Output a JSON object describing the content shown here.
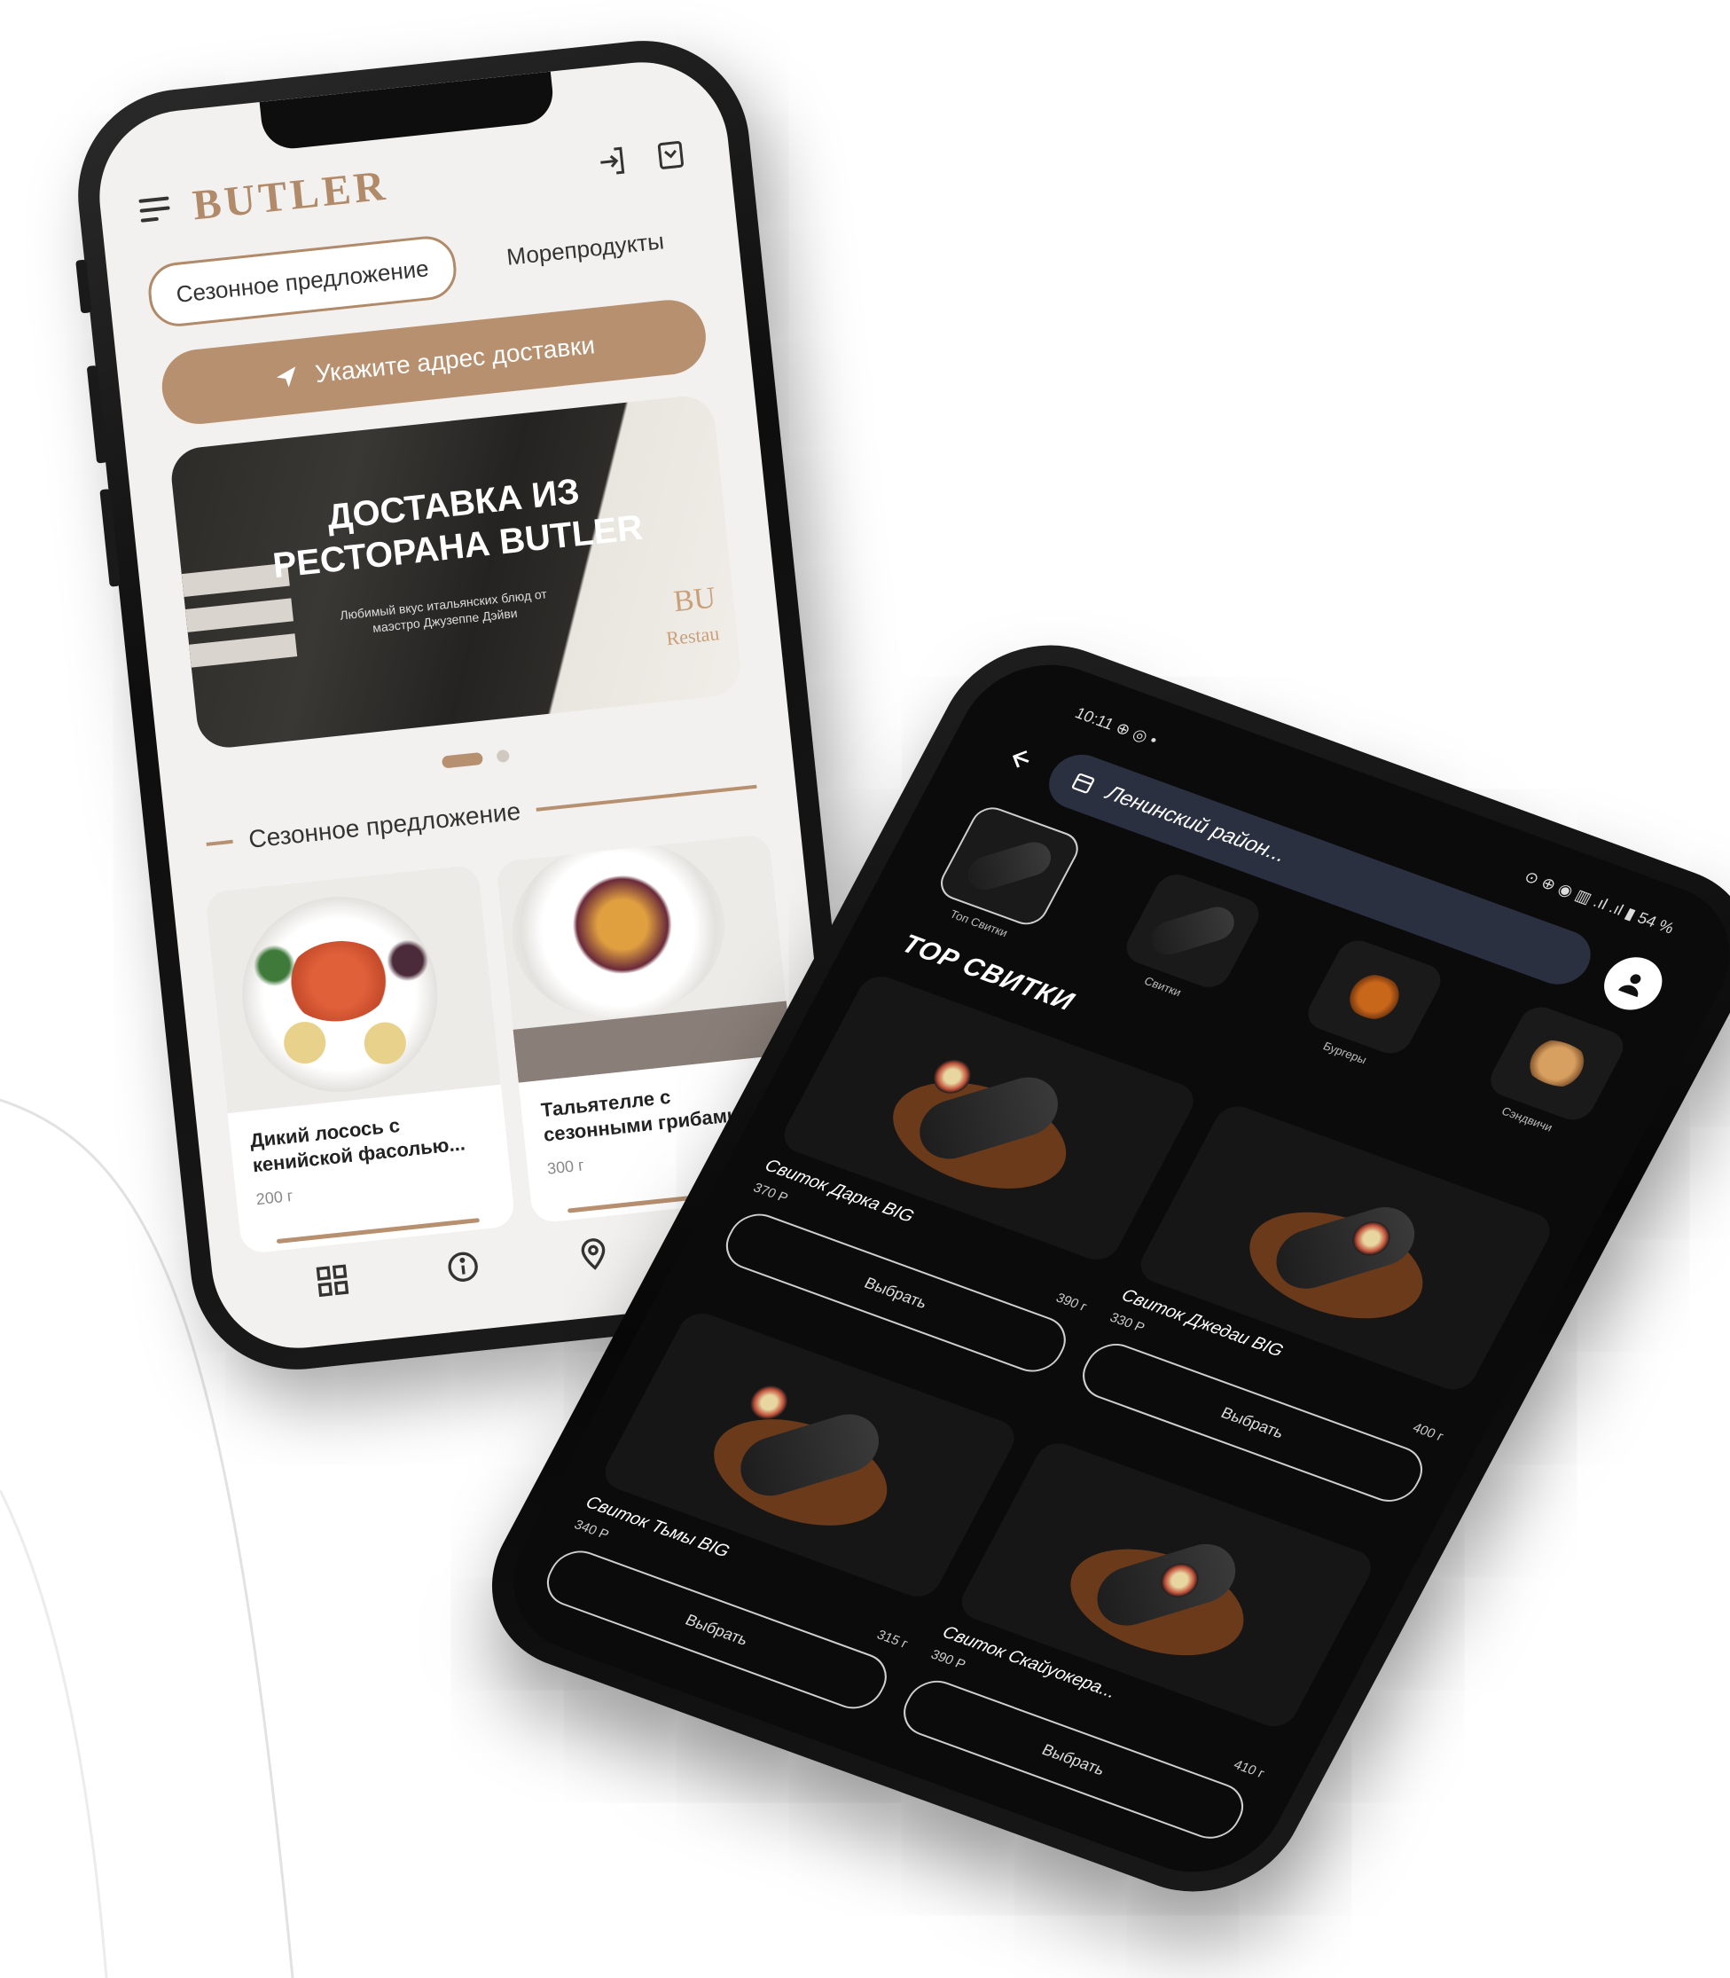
{
  "phone_light": {
    "logo": "BUTLER",
    "tabs": [
      "Сезонное предложение",
      "Морепродукты"
    ],
    "address_button": "Укажите адрес доставки",
    "banner": {
      "title": "ДОСТАВКА ИЗ РЕСТОРАНА BUTLER",
      "subtitle": "Любимый вкус итальянских блюд от маэстро Джузеппе Дэйви",
      "logo_text": "BU",
      "logo_sub": "Restau"
    },
    "section_title": "Сезонное предложение",
    "cards": [
      {
        "name": "Дикий лосось с кенийской фасолью...",
        "weight": "200 г"
      },
      {
        "name": "Тальятелле с сезонными грибами",
        "weight": "300 г"
      }
    ]
  },
  "phone_dark": {
    "status_left": "10:11 ⊕ ◎ •",
    "status_right": "⊙ ⊕ ◉ ▥ .ıl .ıl ▮ 54 %",
    "address": "Ленинский район...",
    "categories": [
      "Топ Свитки",
      "Свитки",
      "Бургеры",
      "Сэндвичи"
    ],
    "section_title": "TOP СВИТКИ",
    "select_label": "Выбрать",
    "products": [
      {
        "name": "Свиток Дарка BIG",
        "price": "370 Р",
        "weight": "390 г"
      },
      {
        "name": "Свиток Джедаи BIG",
        "price": "330 Р",
        "weight": "400 г"
      },
      {
        "name": "Свиток Тьмы BIG",
        "price": "340 Р",
        "weight": "315 г"
      },
      {
        "name": "Свиток Скайуокера...",
        "price": "390 Р",
        "weight": "410 г"
      }
    ]
  },
  "colors": {
    "accent": "#b7906f",
    "dark_bg": "#0b0b0b",
    "light_bg": "#f2f1ef"
  }
}
